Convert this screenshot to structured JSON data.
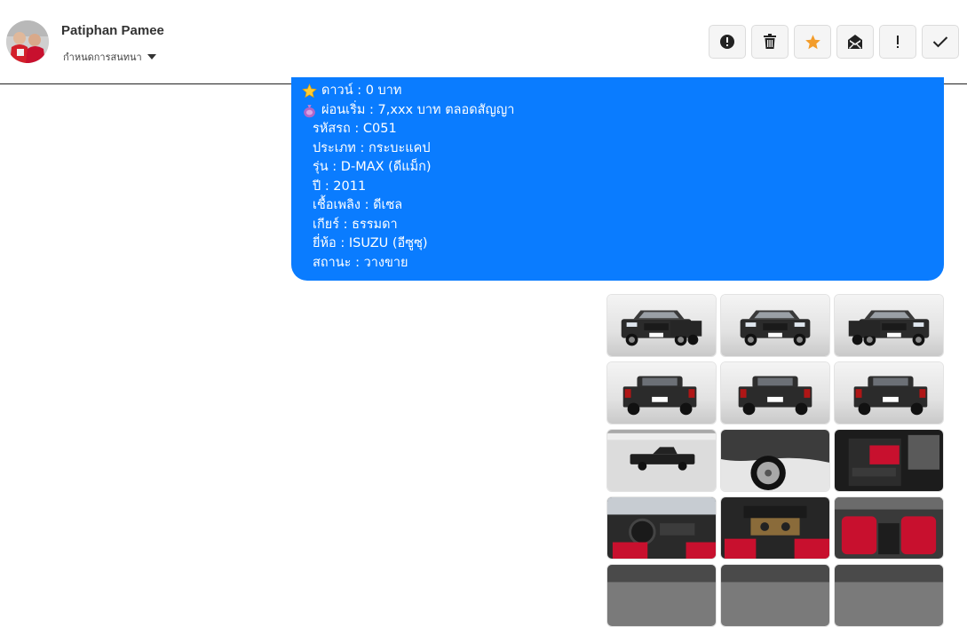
{
  "header": {
    "user_name": "Patiphan Pamee",
    "assign_label": "กำหนดการสนทนา",
    "toolbar": [
      {
        "name": "report-button",
        "icon": "alert-circle-icon"
      },
      {
        "name": "delete-button",
        "icon": "trash-icon"
      },
      {
        "name": "star-button",
        "icon": "star-icon"
      },
      {
        "name": "mark-unread-button",
        "icon": "envelope-open-icon"
      },
      {
        "name": "important-button",
        "icon": "exclamation-icon"
      },
      {
        "name": "done-button",
        "icon": "check-icon"
      }
    ]
  },
  "message": {
    "lines": [
      {
        "icon": "star-emoji",
        "text": "ดาวน์ : 0 บาท"
      },
      {
        "icon": "money-bag-emoji",
        "text": "ผ่อนเริ่ม : 7,xxx บาท ตลอดสัญญา"
      },
      {
        "icon": "",
        "text": "รหัสรถ : C051"
      },
      {
        "icon": "",
        "text": "ประเภท : กระบะแคป"
      },
      {
        "icon": "",
        "text": "รุ่น : D-MAX (ดีแม็ก)"
      },
      {
        "icon": "",
        "text": "ปี : 2011"
      },
      {
        "icon": "",
        "text": "เชื้อเพลิง : ดีเซล"
      },
      {
        "icon": "",
        "text": "เกียร์ : ธรรมดา"
      },
      {
        "icon": "",
        "text": "ยี่ห้อ : ISUZU (อีซูซุ)"
      },
      {
        "icon": "",
        "text": "สถานะ : วางขาย"
      }
    ]
  },
  "colors": {
    "bubble": "#0a7cff",
    "star": "#f5a623",
    "interior_red": "#c8102e",
    "car_black": "#2b2b2b"
  },
  "photos": [
    {
      "kind": "front-left"
    },
    {
      "kind": "front"
    },
    {
      "kind": "front-right"
    },
    {
      "kind": "rear-left"
    },
    {
      "kind": "rear"
    },
    {
      "kind": "rear-right"
    },
    {
      "kind": "side"
    },
    {
      "kind": "wheel"
    },
    {
      "kind": "door-interior"
    },
    {
      "kind": "dashboard"
    },
    {
      "kind": "console"
    },
    {
      "kind": "seats"
    },
    {
      "kind": "partial"
    },
    {
      "kind": "partial"
    },
    {
      "kind": "partial"
    }
  ]
}
